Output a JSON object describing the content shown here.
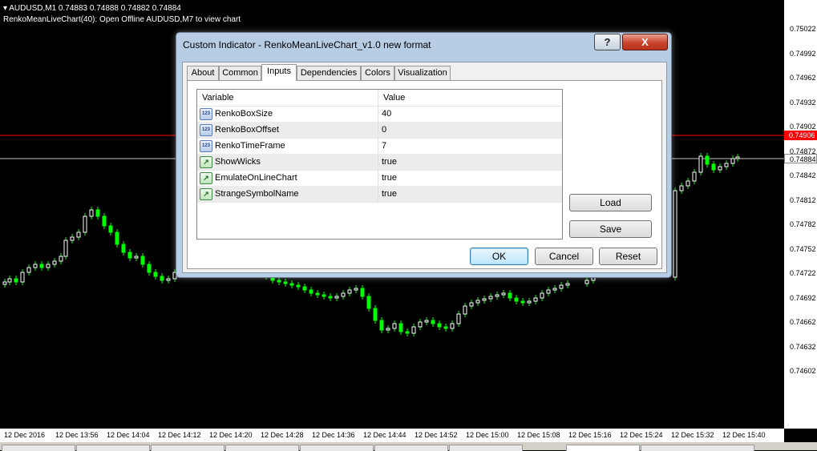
{
  "chart": {
    "symbol_line": "AUDUSD,M1  0.74883 0.74888 0.74882 0.74884",
    "indicator_line": "RenkoMeanLiveChart(40): Open Offline AUDUSD,M7 to view chart",
    "colors": {
      "background": "#000000",
      "bull_candle": "#ffffff",
      "bear_candle": "#00ff00",
      "ask_line": "#ff0000",
      "bid_line": "#c0c0c0"
    },
    "price_labels": [
      "0.75022",
      "0.74992",
      "0.74962",
      "0.74932",
      "0.74902",
      "0.74872",
      "0.74842",
      "0.74812",
      "0.74782",
      "0.74752",
      "0.74722",
      "0.74692",
      "0.74662",
      "0.74632",
      "0.74602"
    ],
    "ask_badge": "0.74906",
    "bid_badge": "0.74884",
    "time_labels": [
      "12 Dec 2016",
      "12 Dec 13:56",
      "12 Dec 14:04",
      "12 Dec 14:12",
      "12 Dec 14:20",
      "12 Dec 14:28",
      "12 Dec 14:36",
      "12 Dec 14:44",
      "12 Dec 14:52",
      "12 Dec 15:00",
      "12 Dec 15:08",
      "12 Dec 15:16",
      "12 Dec 15:24",
      "12 Dec 15:32",
      "12 Dec 15:40"
    ]
  },
  "dialog": {
    "title": "Custom Indicator - RenkoMeanLiveChart_v1.0 new format",
    "help_label": "?",
    "close_label": "X",
    "tabs": [
      "About",
      "Common",
      "Inputs",
      "Dependencies",
      "Colors",
      "Visualization"
    ],
    "active_tab": "Inputs",
    "grid_headers": {
      "variable": "Variable",
      "value": "Value"
    },
    "inputs": [
      {
        "icon": "int-icon",
        "badge": "123",
        "variable": "RenkoBoxSize",
        "value": "40"
      },
      {
        "icon": "int-icon",
        "badge": "123",
        "variable": "RenkoBoxOffset",
        "value": "0"
      },
      {
        "icon": "int-icon",
        "badge": "123",
        "variable": "RenkoTimeFrame",
        "value": "7"
      },
      {
        "icon": "bool-icon",
        "badge": "↗",
        "variable": "ShowWicks",
        "value": "true"
      },
      {
        "icon": "bool-icon",
        "badge": "↗",
        "variable": "EmulateOnLineChart",
        "value": "true"
      },
      {
        "icon": "bool-icon",
        "badge": "↗",
        "variable": "StrangeSymbolName",
        "value": "true"
      }
    ],
    "buttons": {
      "load": "Load",
      "save": "Save",
      "ok": "OK",
      "cancel": "Cancel",
      "reset": "Reset"
    }
  }
}
